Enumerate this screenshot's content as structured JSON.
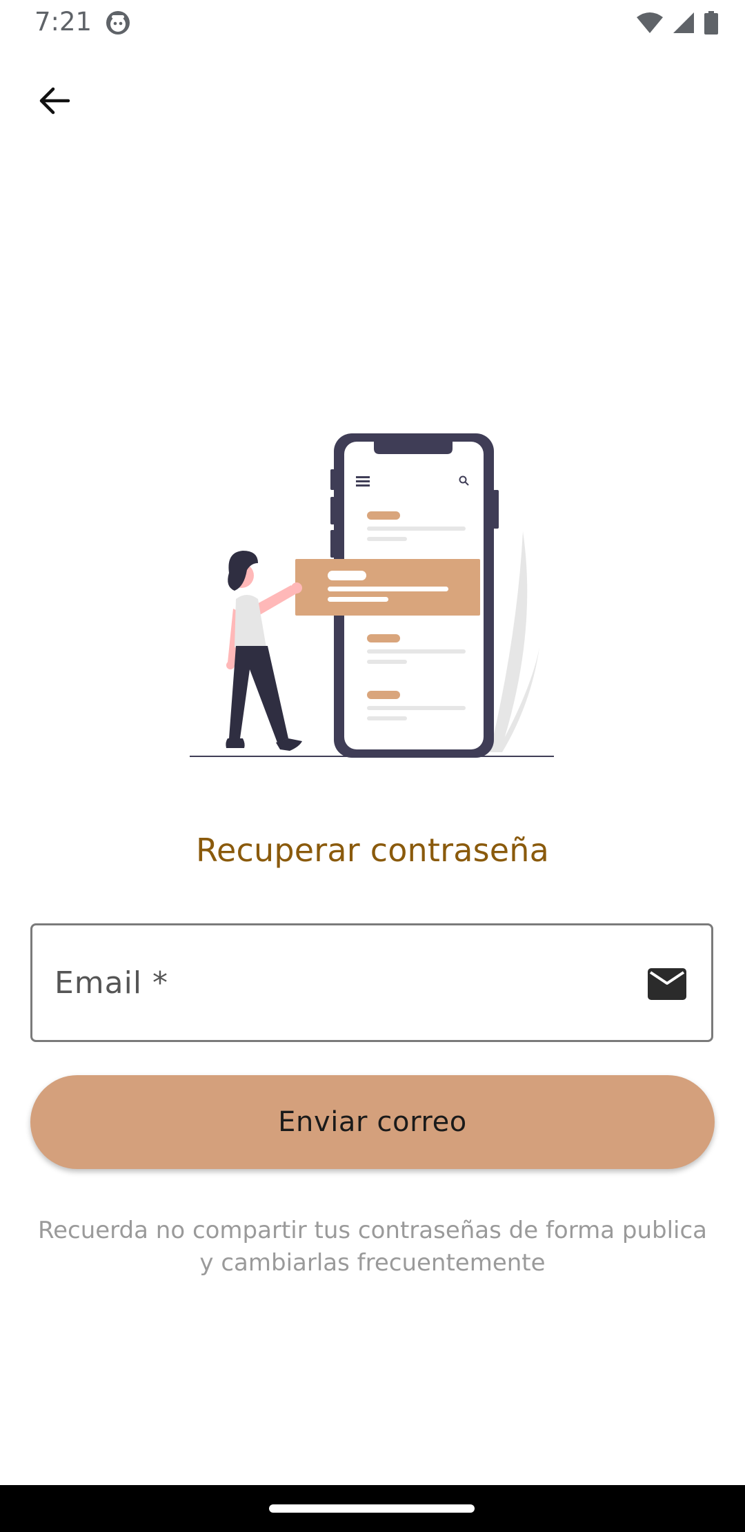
{
  "status_bar": {
    "time": "7:21",
    "app_icon": "android-app-icon",
    "icons": [
      "wifi-icon",
      "signal-icon",
      "battery-icon"
    ]
  },
  "app_bar": {
    "back_icon": "arrow-left-icon"
  },
  "illustration": {
    "icon": "forgot-password-illustration"
  },
  "main": {
    "title": "Recuperar contraseña",
    "email_field": {
      "label": "Email *",
      "value": "",
      "icon": "mail-icon"
    },
    "send_button_label": "Enviar correo",
    "hint_line1": "Recuerda no compartir tus contraseñas de forma publica",
    "hint_line2": "y cambiarlas frecuentemente"
  },
  "colors": {
    "title": "#8a5a0c",
    "button": "#d4a07c",
    "hint": "#9a9a9a",
    "accent_card": "#d9a57c",
    "phone_frame": "#3f3d56"
  }
}
